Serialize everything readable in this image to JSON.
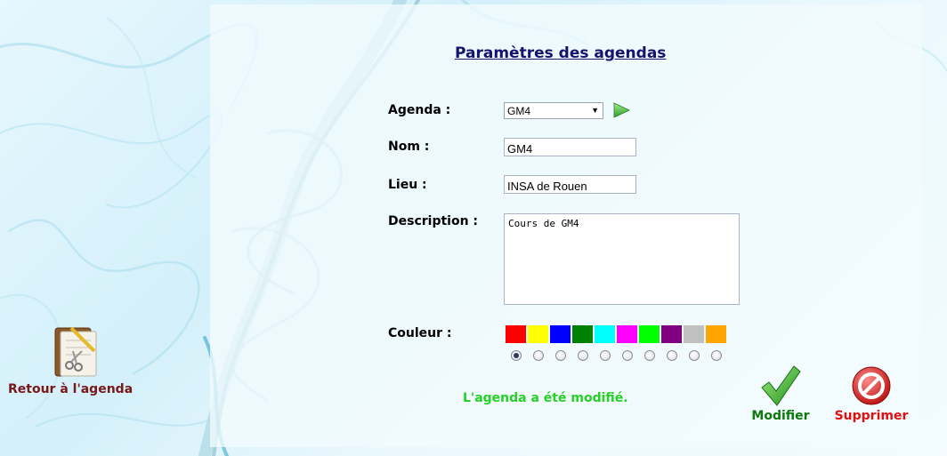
{
  "page": {
    "title": "Paramètres des agendas",
    "back_label": "Retour à l'agenda"
  },
  "form": {
    "agenda_label": "Agenda :",
    "agenda_selected": "GM4",
    "nom_label": "Nom :",
    "nom_value": "GM4",
    "lieu_label": "Lieu :",
    "lieu_value": "INSA de Rouen",
    "description_label": "Description :",
    "description_value": "Cours de GM4",
    "couleur_label": "Couleur :",
    "colors": [
      "#ff0000",
      "#ffff00",
      "#0000ff",
      "#008000",
      "#00ffff",
      "#ff00ff",
      "#00ff00",
      "#800080",
      "#c0c0c0",
      "#ffa500"
    ],
    "selected_color_index": 0
  },
  "status_message": "L'agenda a été modifié.",
  "actions": {
    "modify_label": "Modifier",
    "delete_label": "Supprimer"
  }
}
